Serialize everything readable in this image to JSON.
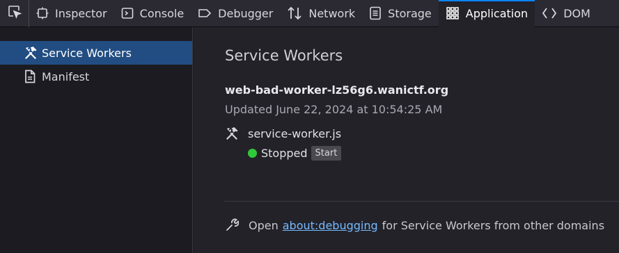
{
  "toolbar": {
    "picker_icon": "element-picker-icon",
    "tabs": [
      {
        "label": "Inspector",
        "icon": "inspector-icon"
      },
      {
        "label": "Console",
        "icon": "console-icon"
      },
      {
        "label": "Debugger",
        "icon": "debugger-icon"
      },
      {
        "label": "Network",
        "icon": "network-icon"
      },
      {
        "label": "Storage",
        "icon": "storage-icon"
      },
      {
        "label": "Application",
        "icon": "application-icon",
        "active": true
      },
      {
        "label": "DOM",
        "icon": "dom-icon"
      }
    ]
  },
  "sidebar": {
    "items": [
      {
        "label": "Service Workers",
        "icon": "hammer-icon",
        "selected": true
      },
      {
        "label": "Manifest",
        "icon": "document-icon"
      }
    ]
  },
  "main": {
    "title": "Service Workers",
    "domain": "web-bad-worker-lz56g6.wanictf.org",
    "updated": "Updated June 22, 2024 at 10:54:25 AM",
    "worker_file": "service-worker.js",
    "status": "Stopped",
    "start_label": "Start",
    "footer": {
      "prefix": "Open",
      "link": "about:debugging",
      "suffix": "for Service Workers from other domains"
    }
  },
  "colors": {
    "accent": "#0a84ff",
    "selection": "#214d82",
    "status_running": "#30c93a",
    "link": "#75baff"
  }
}
